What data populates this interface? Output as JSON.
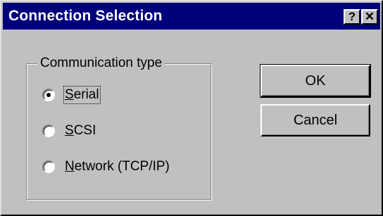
{
  "window": {
    "title": "Connection Selection",
    "help_label": "?",
    "close_label": "✕"
  },
  "communication_group": {
    "legend": "Communication type",
    "options": [
      {
        "label": "Serial",
        "accel": "S",
        "rest": "erial",
        "checked": true
      },
      {
        "label": "SCSI",
        "accel": "S",
        "rest": "CSI",
        "checked": false
      },
      {
        "label": "Network (TCP/IP)",
        "accel": "N",
        "rest": "etwork (TCP/IP)",
        "checked": false
      }
    ]
  },
  "buttons": {
    "ok_label": "OK",
    "cancel_label": "Cancel"
  },
  "colors": {
    "titlebar": "#00007b",
    "face": "#c0c0c0"
  }
}
